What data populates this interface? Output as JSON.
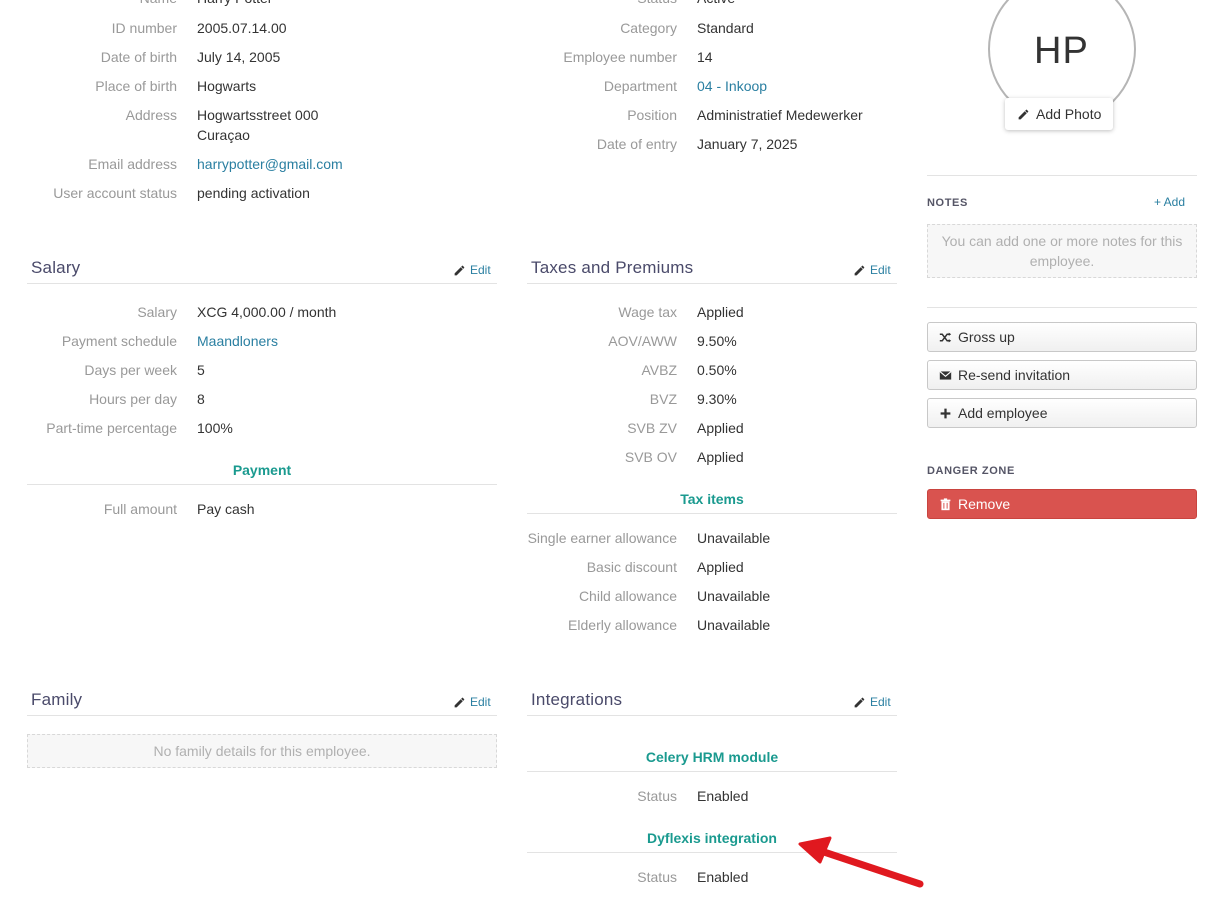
{
  "personal": {
    "rows": [
      {
        "label": "Name",
        "value": "Harry Potter"
      },
      {
        "label": "ID number",
        "value": "2005.07.14.00"
      },
      {
        "label": "Date of birth",
        "value": "July 14, 2005"
      },
      {
        "label": "Place of birth",
        "value": "Hogwarts"
      },
      {
        "label": "Address",
        "value": "Hogwartsstreet 000",
        "value2": "Curaçao"
      },
      {
        "label": "Email address",
        "value": "harrypotter@gmail.com"
      },
      {
        "label": "User account status",
        "value": "pending activation"
      }
    ]
  },
  "employment": {
    "rows": [
      {
        "label": "Status",
        "value": "Active"
      },
      {
        "label": "Category",
        "value": "Standard"
      },
      {
        "label": "Employee number",
        "value": "14"
      },
      {
        "label": "Department",
        "value": "04 - Inkoop"
      },
      {
        "label": "Position",
        "value": "Administratief Medewerker"
      },
      {
        "label": "Date of entry",
        "value": "January 7, 2025"
      }
    ]
  },
  "salary": {
    "title": "Salary",
    "edit": "Edit",
    "rows": [
      {
        "label": "Salary",
        "value": "XCG 4,000.00 / month"
      },
      {
        "label": "Payment schedule",
        "value": "Maandloners"
      },
      {
        "label": "Days per week",
        "value": "5"
      },
      {
        "label": "Hours per day",
        "value": "8"
      },
      {
        "label": "Part-time percentage",
        "value": "100%"
      }
    ],
    "payment_heading": "Payment",
    "payment_rows": [
      {
        "label": "Full amount",
        "value": "Pay cash"
      }
    ]
  },
  "taxes": {
    "title": "Taxes and Premiums",
    "edit": "Edit",
    "rows": [
      {
        "label": "Wage tax",
        "value": "Applied"
      },
      {
        "label": "AOV/AWW",
        "value": "9.50%"
      },
      {
        "label": "AVBZ",
        "value": "0.50%"
      },
      {
        "label": "BVZ",
        "value": "9.30%"
      },
      {
        "label": "SVB ZV",
        "value": "Applied"
      },
      {
        "label": "SVB OV",
        "value": "Applied"
      }
    ],
    "items_heading": "Tax items",
    "items_rows": [
      {
        "label": "Single earner allowance",
        "value": "Unavailable"
      },
      {
        "label": "Basic discount",
        "value": "Applied"
      },
      {
        "label": "Child allowance",
        "value": "Unavailable"
      },
      {
        "label": "Elderly allowance",
        "value": "Unavailable"
      }
    ]
  },
  "family": {
    "title": "Family",
    "edit": "Edit",
    "empty": "No family details for this employee."
  },
  "integrations": {
    "title": "Integrations",
    "edit": "Edit",
    "groups": [
      {
        "heading": "Celery HRM module",
        "label": "Status",
        "value": "Enabled"
      },
      {
        "heading": "Dyflexis integration",
        "label": "Status",
        "value": "Enabled"
      }
    ]
  },
  "sidebar": {
    "initials": "HP",
    "add_photo": "Add Photo",
    "notes_heading": "NOTES",
    "notes_add": "+ Add",
    "notes_empty": "You can add one or more notes for this employee.",
    "buttons": {
      "gross_up": "Gross up",
      "resend": "Re-send invitation",
      "add_employee": "Add employee"
    },
    "danger_heading": "DANGER ZONE",
    "remove": "Remove"
  },
  "colors": {
    "link": "#2a7fa1",
    "subheading": "#1a9a8f",
    "danger": "#d9534f",
    "annotation_arrow": "#e0191f"
  }
}
